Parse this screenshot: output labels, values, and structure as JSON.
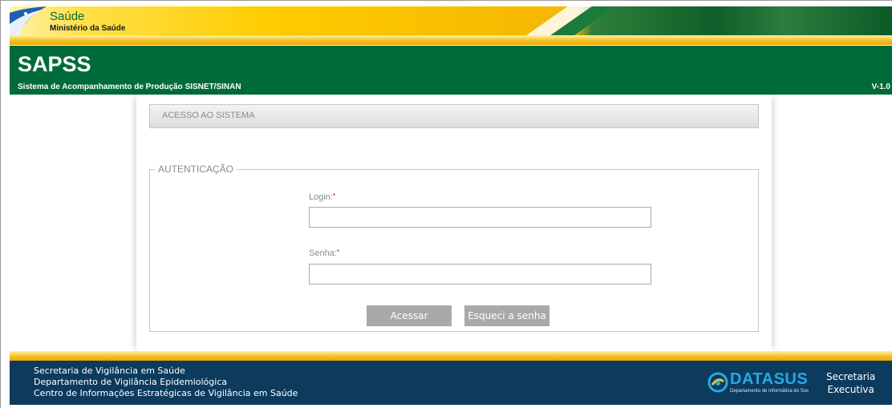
{
  "banner": {
    "brand_title": "Saúde",
    "brand_subtitle": "Ministério da Saúde"
  },
  "header": {
    "app_title": "SAPSS",
    "app_subtitle": "Sistema de Acompanhamento de Produção SISNET/SINAN",
    "version": "V-1.0"
  },
  "main": {
    "section_title": "ACESSO AO SISTEMA",
    "auth_legend": "AUTENTICAÇÃO",
    "login_label": "Login:",
    "login_required": "*",
    "login_value": "",
    "password_label": "Senha:",
    "password_required": "*",
    "password_value": "",
    "submit_label": "Acessar",
    "forgot_label": "Esqueci a senha"
  },
  "footer": {
    "lines": [
      "Secretaria de Vigilância em Saúde",
      "Departamento de Vigilância Epidemiológica",
      "Centro de Informações Estratégicas de Vigilância em Saúde"
    ],
    "datasus_name": "DATASUS",
    "datasus_sub": "Departamento de Informática do Sus",
    "secexec_line1": "Secretaria",
    "secexec_line2": "Executiva"
  },
  "colors": {
    "header_green": "#006b39",
    "gold": "#f6c22b",
    "footer_blue": "#0d3b5e",
    "button_gray": "#a9a9a9",
    "datasus_blue": "#28a8e0"
  },
  "icons": [
    "flag-swoosh-icon",
    "datasus-logo-icon"
  ]
}
